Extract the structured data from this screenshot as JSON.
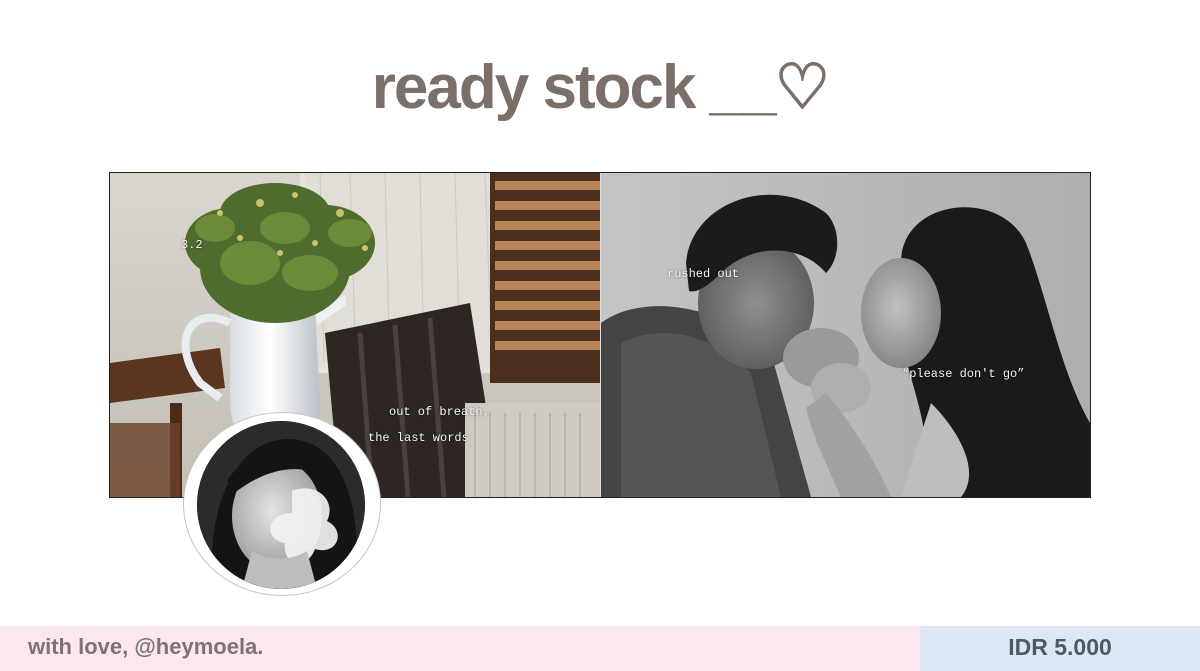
{
  "title": "ready stock __♡",
  "collage": {
    "left_photo": {
      "caption_number": "3.2",
      "caption_line1": "out of breath,",
      "caption_line2": "the last words"
    },
    "right_photo": {
      "caption_top": "rushed out",
      "caption_quote": "“please don't go”"
    }
  },
  "footer": {
    "credit": "with love, @heymoela.",
    "price": "IDR 5.000"
  },
  "colors": {
    "title": "#7b6f6a",
    "footer_left_bg": "#fce6ef",
    "footer_right_bg": "#dce9f5",
    "credit_text": "#7a7473",
    "price_text": "#4f5963"
  }
}
